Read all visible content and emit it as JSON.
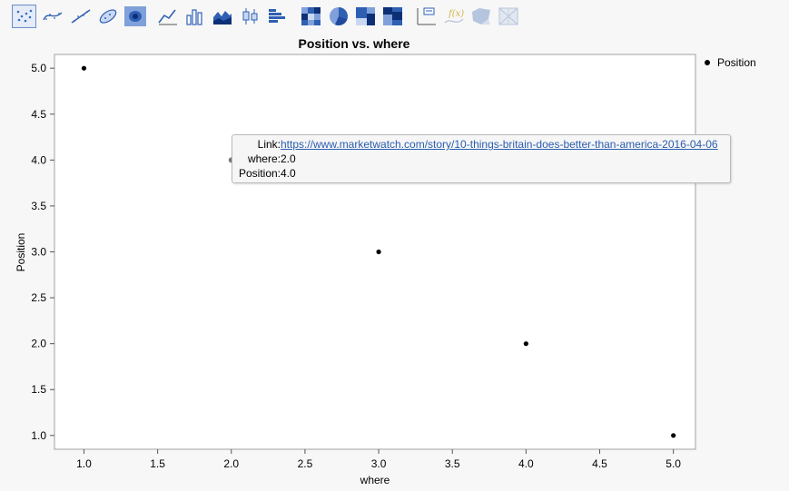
{
  "toolbar": {
    "icons": [
      "points-icon",
      "smoother-icon",
      "line-of-fit-icon",
      "ellipse-icon",
      "contour-icon",
      "line-icon",
      "bar-icon",
      "area-icon",
      "box-plot-icon",
      "histogram-icon",
      "heatmap-icon",
      "pie-icon",
      "treemap-icon",
      "mosaic-icon",
      "caption-box-icon",
      "formula-icon",
      "map-shapes-icon",
      "map-grid-icon"
    ],
    "active": "points-icon",
    "accent": "#3a6cc4"
  },
  "chart_data": {
    "type": "scatter",
    "title": "Position vs. where",
    "xlabel": "where",
    "ylabel": "Position",
    "xlim": [
      0.8,
      5.15
    ],
    "ylim": [
      0.85,
      5.15
    ],
    "xticks": [
      "1.0",
      "1.5",
      "2.0",
      "2.5",
      "3.0",
      "3.5",
      "4.0",
      "4.5",
      "5.0"
    ],
    "yticks": [
      "1.0",
      "1.5",
      "2.0",
      "2.5",
      "3.0",
      "3.5",
      "4.0",
      "4.5",
      "5.0"
    ],
    "grid": false,
    "legend_position": "right",
    "series": [
      {
        "name": "Position",
        "color": "#000000",
        "x": [
          1.0,
          2.0,
          3.0,
          4.0,
          5.0
        ],
        "y": [
          5.0,
          4.0,
          3.0,
          2.0,
          1.0
        ]
      }
    ],
    "highlighted_index": 1
  },
  "tooltip": {
    "link_label": "Link:",
    "link_value": "https://www.marketwatch.com/story/10-things-britain-does-better-than-america-2016-04-06",
    "where_label": "where:",
    "where_value": "2.0",
    "position_label": "Position:",
    "position_value": "4.0"
  }
}
